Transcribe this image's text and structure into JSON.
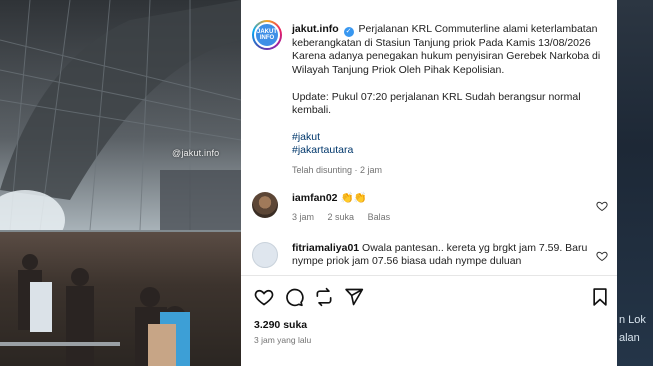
{
  "photo": {
    "watermark": "@jakut.info"
  },
  "post": {
    "username": "jakut.info",
    "avatar_text": "JAKUT INFO",
    "caption_line1": "Perjalanan KRL Commuterline alami keterlambatan keberangkatan di Stasiun Tanjung priok Pada Kamis 13/08/2026 Karena adanya penegakan hukum penyisiran Gerebek Narkoba di Wilayah Tanjung Priok Oleh Pihak Kepolisian.",
    "caption_update": "Update: Pukul 07:20 perjalanan KRL Sudah berangsur normal kembali.",
    "hashtags": [
      "#jakut",
      "#jakartautara"
    ],
    "edited_time": "Telah disunting · 2 jam"
  },
  "comments": [
    {
      "username": "iamfan02",
      "text": "👏👏",
      "time": "3 jam",
      "likes": "2 suka",
      "reply": "Balas"
    },
    {
      "username": "fitriamaliya01",
      "text": "Owala pantesan.. kereta yg brgkt jam 7.59. Baru nympe priok jam 07.56 biasa udah nympe duluan"
    }
  ],
  "footer": {
    "likes": "3.290 suka",
    "time_ago": "3 jam yang lalu"
  },
  "right_panel": {
    "text1": "n Lok",
    "text2": "alan"
  },
  "colors": {
    "link": "#00376b",
    "verified": "#3897f0",
    "muted": "#737373"
  }
}
